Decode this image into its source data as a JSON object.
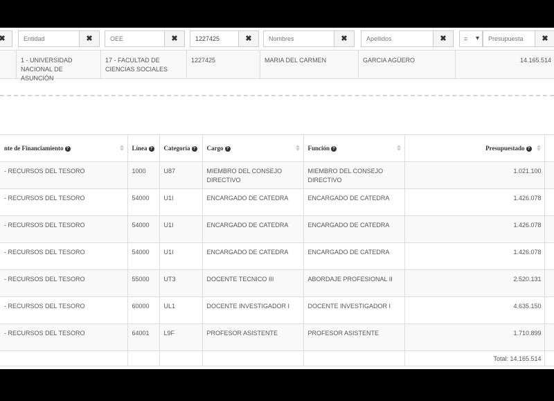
{
  "filters": {
    "entidad_placeholder": "Entidad",
    "oee_placeholder": "OEE",
    "cedula_value": "1227425",
    "nombres_placeholder": "Nombres",
    "apellidos_placeholder": "Apellidos",
    "operator": "=",
    "presupuesto_placeholder": "Presupuesta",
    "clear_label": "✖",
    "select_arrow": "▾"
  },
  "summary": {
    "entidad": "1 - UNIVERSIDAD NACIONAL DE ASUNCIÓN",
    "oee": "17 - FACULTAD DE CIENCIAS SOCIALES",
    "cedula": "1227425",
    "nombres": "MARIA DEL CARMEN",
    "apellidos": "GARCIA AGÜERO",
    "presupuestado": "14.165.514"
  },
  "table": {
    "headers": {
      "fuente": "nte de Financiamiento",
      "linea": "Línea",
      "categoria": "Categoría",
      "cargo": "Cargo",
      "funcion": "Función",
      "presupuestado": "Presupuestado"
    },
    "help_icon": "?",
    "rows": [
      {
        "fuente": "- RECURSOS DEL TESORO",
        "linea": "1000",
        "categoria": "U87",
        "cargo": "MIEMBRO DEL CONSEJO DIRECTIVO",
        "funcion": "MIEMBRO DEL CONSEJO DIRECTIVO",
        "presupuestado": "1.021.100"
      },
      {
        "fuente": "- RECURSOS DEL TESORO",
        "linea": "54000",
        "categoria": "U1I",
        "cargo": "ENCARGADO DE CATEDRA",
        "funcion": "ENCARGADO DE CATEDRA",
        "presupuestado": "1.426.078"
      },
      {
        "fuente": "- RECURSOS DEL TESORO",
        "linea": "54000",
        "categoria": "U1I",
        "cargo": "ENCARGADO DE CATEDRA",
        "funcion": "ENCARGADO DE CATEDRA",
        "presupuestado": "1.426.078"
      },
      {
        "fuente": "- RECURSOS DEL TESORO",
        "linea": "54000",
        "categoria": "U1I",
        "cargo": "ENCARGADO DE CATEDRA",
        "funcion": "ENCARGADO DE CATEDRA",
        "presupuestado": "1.426.078"
      },
      {
        "fuente": "- RECURSOS DEL TESORO",
        "linea": "55000",
        "categoria": "UT3",
        "cargo": "DOCENTE TECNICO III",
        "funcion": "ABORDAJE PROFESIONAL II",
        "presupuestado": "2.520.131"
      },
      {
        "fuente": "- RECURSOS DEL TESORO",
        "linea": "60000",
        "categoria": "UL1",
        "cargo": "DOCENTE INVESTIGADOR I",
        "funcion": "DOCENTE INVESTIGADOR I",
        "presupuestado": "4.635.150"
      },
      {
        "fuente": "- RECURSOS DEL TESORO",
        "linea": "64001",
        "categoria": "L9F",
        "cargo": "PROFESOR ASISTENTE",
        "funcion": "PROFESOR ASISTENTE",
        "presupuestado": "1.710.899"
      }
    ],
    "total_label": "Total: 14.165.514"
  }
}
